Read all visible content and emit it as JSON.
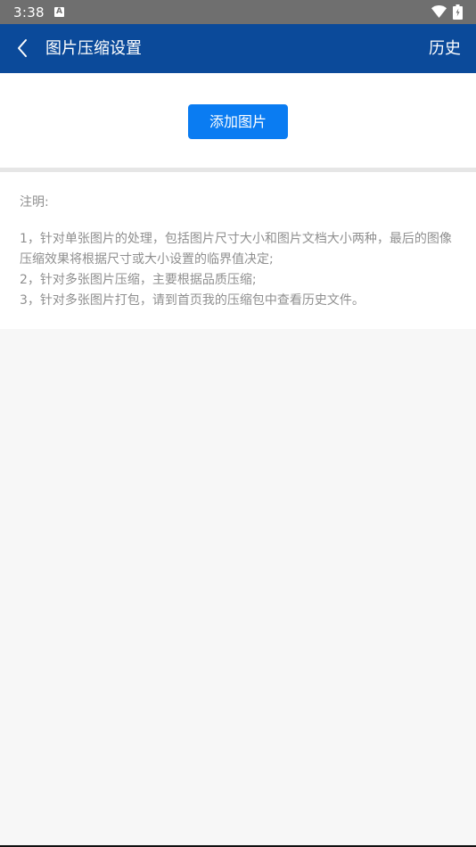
{
  "status_bar": {
    "time": "3:38",
    "a_icon_letter": "A",
    "icons": [
      "a-icon",
      "wifi-icon",
      "battery-icon"
    ]
  },
  "toolbar": {
    "back_icon": "chevron-left-icon",
    "title": "图片压缩设置",
    "history_label": "历史",
    "background_color": "#0b4a9a"
  },
  "add_section": {
    "add_button_label": "添加图片",
    "button_color": "#0a7cf2"
  },
  "notes": {
    "title": "注明:",
    "lines": [
      "1，针对单张图片的处理，包括图片尺寸大小和图片文档大小两种，最后的图像压缩效果将根据尺寸或大小设置的临界值决定;",
      "2，针对多张图片压缩，主要根据品质压缩;",
      "3，针对多张图片打包，请到首页我的压缩包中查看历史文件。"
    ]
  }
}
